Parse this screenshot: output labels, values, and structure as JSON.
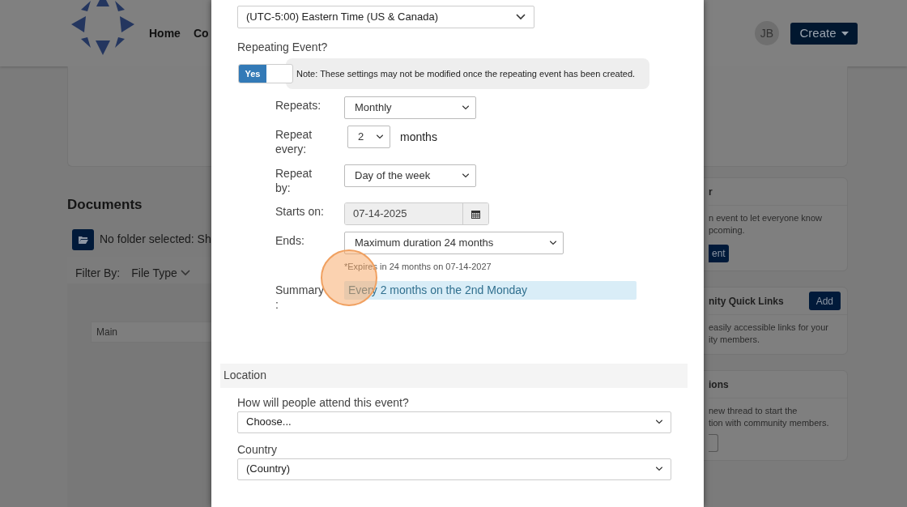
{
  "header": {
    "nav": [
      {
        "label": "Home"
      },
      {
        "label": "Co"
      }
    ],
    "avatar": "JB",
    "create_button": "Create"
  },
  "documents": {
    "title": "Documents",
    "folder_status": "No folder selected: Sh",
    "filter_label": "Filter By:",
    "filter_value": "File Type",
    "folder_field": "Main"
  },
  "right_cards": [
    {
      "title": "r",
      "lines": [
        "n event to let everyone know",
        "pcoming."
      ],
      "button": "ent"
    },
    {
      "title": "nity Quick Links",
      "header_button": "Add",
      "lines": [
        "easily accessible links for your",
        "ity members."
      ]
    },
    {
      "title": "ions",
      "lines": [
        "new thread to start the",
        "tion with community members."
      ],
      "outline_button": true
    }
  ],
  "modal": {
    "timezone": "(UTC-5:00) Eastern Time (US & Canada)",
    "repeating_label": "Repeating Event?",
    "repeating_toggle": {
      "on": true,
      "label": "Yes"
    },
    "note": "Note: These settings may not be modified once the repeating event has been created.",
    "rows": [
      {
        "kind": "select",
        "label": "Repeats:",
        "value": "Monthly"
      },
      {
        "kind": "number",
        "label": "Repeat every:",
        "value": "2",
        "unit": "months"
      },
      {
        "kind": "select",
        "label": "Repeat by:",
        "value": "Day of the week"
      },
      {
        "kind": "date",
        "label": "Starts on:",
        "value": "07-14-2025"
      },
      {
        "kind": "wide",
        "label": "Ends:",
        "value": "Maximum duration 24 months",
        "hint": "*Expires in 24 months on 07-14-2027"
      },
      {
        "kind": "summary",
        "label": "Summary :",
        "value": "Every 2 months on the 2nd Monday"
      }
    ],
    "sections": [
      {
        "title": "Location",
        "fields": [
          {
            "label": "How will people attend this event?",
            "value": "Choose..."
          },
          {
            "label": "Country",
            "value": "(Country)"
          }
        ]
      }
    ]
  }
}
